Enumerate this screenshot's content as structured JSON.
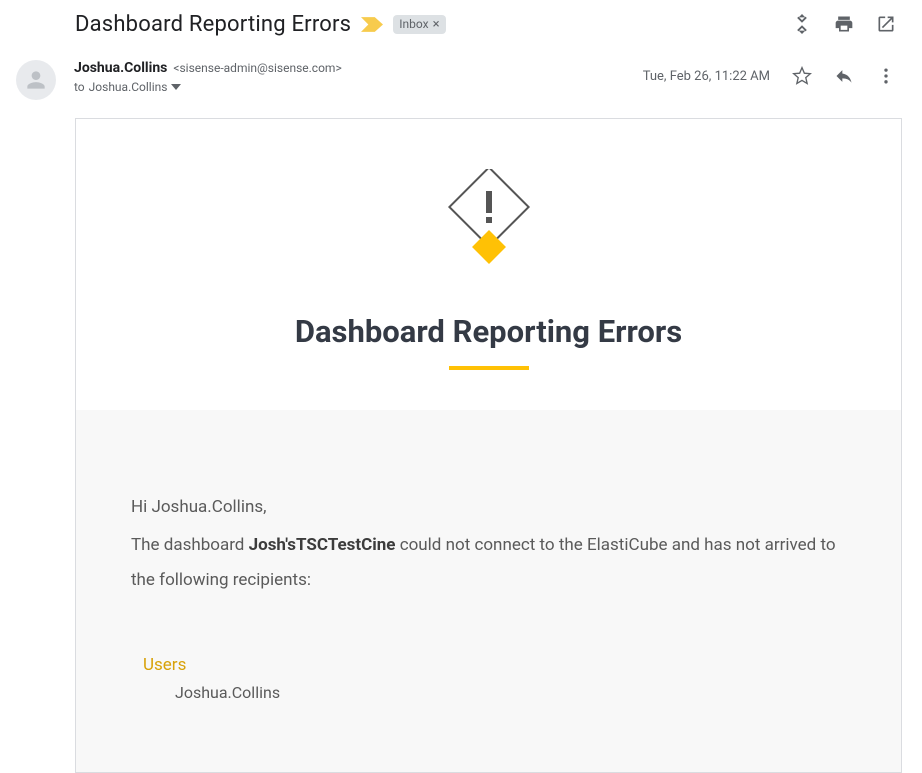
{
  "header": {
    "subject": "Dashboard Reporting Errors",
    "inbox_label": "Inbox"
  },
  "meta": {
    "sender_name": "Joshua.Collins",
    "sender_email": "<sisense-admin@sisense.com>",
    "to_prefix": "to ",
    "to_recipient": "Joshua.Collins",
    "timestamp": "Tue, Feb 26, 11:22 AM"
  },
  "body": {
    "hero_title": "Dashboard Reporting Errors",
    "greeting": "Hi Joshua.Collins,",
    "line_before": "The dashboard ",
    "dashboard_name": "Josh'sTSCTestCine",
    "line_after": " could not connect to the ElastiCube and has not arrived to the following recipients:",
    "users_heading": "Users",
    "users": [
      "Joshua.Collins"
    ]
  },
  "colors": {
    "accent": "#ffc105",
    "hero_text": "#343a45",
    "body_text": "#5a5a5a",
    "gmail_gray": "#5f6368"
  }
}
